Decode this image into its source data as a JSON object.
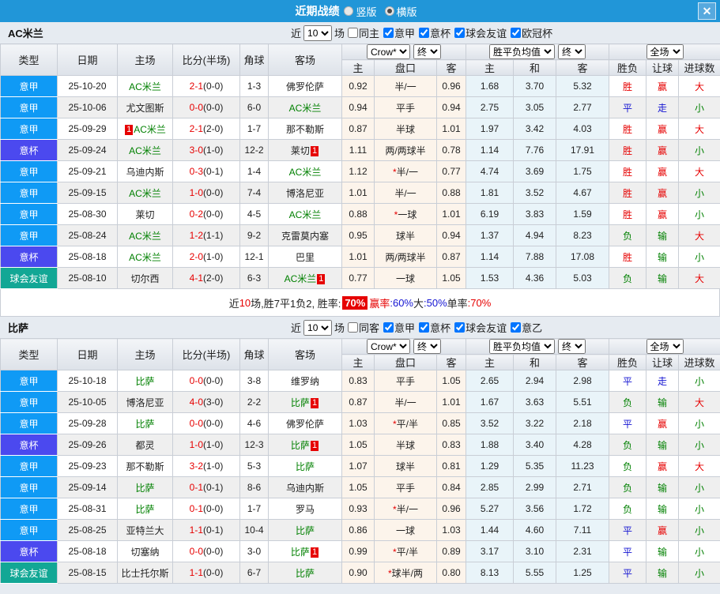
{
  "titlebar": {
    "title": "近期战绩",
    "radios": [
      {
        "label": "竖版",
        "checked": false
      },
      {
        "label": "横版",
        "checked": true
      }
    ],
    "close_glyph": "✕"
  },
  "header": {
    "cols": [
      "类型",
      "日期",
      "主场",
      "比分(半场)",
      "角球",
      "客场"
    ],
    "sub": [
      "主",
      "盘口",
      "客",
      "主",
      "和",
      "客",
      "胜负",
      "让球",
      "进球数"
    ],
    "selects": {
      "odds_source": "Crow*",
      "odds_state": "终",
      "avg_label": "胜平负均值",
      "avg_state": "终",
      "scope": "全场"
    }
  },
  "colors": {
    "league": {
      "意甲": "#0f9af5",
      "意杯": "#4b49ef",
      "球会友谊": "#12a795"
    },
    "result": {
      "r": "#e60000",
      "b": "#1414d2",
      "g": "#008000"
    }
  },
  "teams": [
    {
      "name": "AC米兰",
      "filter": {
        "near": "近",
        "count": "10",
        "games": "场",
        "same": {
          "label": "同主",
          "checked": false
        },
        "leagues": [
          {
            "label": "意甲",
            "checked": true
          },
          {
            "label": "意杯",
            "checked": true
          },
          {
            "label": "球会友谊",
            "checked": true
          },
          {
            "label": "欧冠杯",
            "checked": true
          }
        ]
      },
      "rows": [
        {
          "type": "意甲",
          "date": "25-10-20",
          "home": {
            "name": "AC米兰",
            "green": true
          },
          "score_ft": "2-1",
          "score_ht": "(0-0)",
          "corner": "1-3",
          "away": {
            "name": "佛罗伦萨",
            "green": false
          },
          "odds": [
            "0.92",
            "半/一",
            "0.96"
          ],
          "avg": [
            "1.68",
            "3.70",
            "5.32"
          ],
          "res": [
            [
              "胜",
              "r"
            ],
            [
              "赢",
              "r"
            ],
            [
              "大",
              "r"
            ]
          ]
        },
        {
          "type": "意甲",
          "date": "25-10-06",
          "home": {
            "name": "尤文图斯",
            "green": false
          },
          "score_ft": "0-0",
          "score_ht": "(0-0)",
          "corner": "6-0",
          "away": {
            "name": "AC米兰",
            "green": true
          },
          "odds": [
            "0.94",
            "平手",
            "0.94"
          ],
          "avg": [
            "2.75",
            "3.05",
            "2.77"
          ],
          "res": [
            [
              "平",
              "b"
            ],
            [
              "走",
              "b"
            ],
            [
              "小",
              "g"
            ]
          ]
        },
        {
          "type": "意甲",
          "date": "25-09-29",
          "home": {
            "name": "AC米兰",
            "green": true,
            "badge": "1",
            "badge_pos": "before"
          },
          "score_ft": "2-1",
          "score_ht": "(2-0)",
          "corner": "1-7",
          "away": {
            "name": "那不勒斯",
            "green": false
          },
          "odds": [
            "0.87",
            "半球",
            "1.01"
          ],
          "avg": [
            "1.97",
            "3.42",
            "4.03"
          ],
          "res": [
            [
              "胜",
              "r"
            ],
            [
              "赢",
              "r"
            ],
            [
              "大",
              "r"
            ]
          ]
        },
        {
          "type": "意杯",
          "date": "25-09-24",
          "home": {
            "name": "AC米兰",
            "green": true
          },
          "score_ft": "3-0",
          "score_ht": "(1-0)",
          "corner": "12-2",
          "away": {
            "name": "莱切",
            "green": false,
            "badge": "1",
            "badge_pos": "after"
          },
          "odds": [
            "1.11",
            "两/两球半",
            "0.78"
          ],
          "avg": [
            "1.14",
            "7.76",
            "17.91"
          ],
          "res": [
            [
              "胜",
              "r"
            ],
            [
              "赢",
              "r"
            ],
            [
              "小",
              "g"
            ]
          ]
        },
        {
          "type": "意甲",
          "date": "25-09-21",
          "home": {
            "name": "乌迪内斯",
            "green": false
          },
          "score_ft": "0-3",
          "score_ht": "(0-1)",
          "corner": "1-4",
          "away": {
            "name": "AC米兰",
            "green": true
          },
          "odds": [
            "1.12",
            "*半/一",
            "0.77"
          ],
          "avg": [
            "4.74",
            "3.69",
            "1.75"
          ],
          "res": [
            [
              "胜",
              "r"
            ],
            [
              "赢",
              "r"
            ],
            [
              "大",
              "r"
            ]
          ]
        },
        {
          "type": "意甲",
          "date": "25-09-15",
          "home": {
            "name": "AC米兰",
            "green": true
          },
          "score_ft": "1-0",
          "score_ht": "(0-0)",
          "corner": "7-4",
          "away": {
            "name": "博洛尼亚",
            "green": false
          },
          "odds": [
            "1.01",
            "半/一",
            "0.88"
          ],
          "avg": [
            "1.81",
            "3.52",
            "4.67"
          ],
          "res": [
            [
              "胜",
              "r"
            ],
            [
              "赢",
              "r"
            ],
            [
              "小",
              "g"
            ]
          ]
        },
        {
          "type": "意甲",
          "date": "25-08-30",
          "home": {
            "name": "莱切",
            "green": false
          },
          "score_ft": "0-2",
          "score_ht": "(0-0)",
          "corner": "4-5",
          "away": {
            "name": "AC米兰",
            "green": true
          },
          "odds": [
            "0.88",
            "*一球",
            "1.01"
          ],
          "avg": [
            "6.19",
            "3.83",
            "1.59"
          ],
          "res": [
            [
              "胜",
              "r"
            ],
            [
              "赢",
              "r"
            ],
            [
              "小",
              "g"
            ]
          ]
        },
        {
          "type": "意甲",
          "date": "25-08-24",
          "home": {
            "name": "AC米兰",
            "green": true
          },
          "score_ft": "1-2",
          "score_ht": "(1-1)",
          "corner": "9-2",
          "away": {
            "name": "克雷莫内塞",
            "green": false
          },
          "odds": [
            "0.95",
            "球半",
            "0.94"
          ],
          "avg": [
            "1.37",
            "4.94",
            "8.23"
          ],
          "res": [
            [
              "负",
              "g"
            ],
            [
              "输",
              "g"
            ],
            [
              "大",
              "r"
            ]
          ]
        },
        {
          "type": "意杯",
          "date": "25-08-18",
          "home": {
            "name": "AC米兰",
            "green": true
          },
          "score_ft": "2-0",
          "score_ht": "(1-0)",
          "corner": "12-1",
          "away": {
            "name": "巴里",
            "green": false
          },
          "odds": [
            "1.01",
            "两/两球半",
            "0.87"
          ],
          "avg": [
            "1.14",
            "7.88",
            "17.08"
          ],
          "res": [
            [
              "胜",
              "r"
            ],
            [
              "输",
              "g"
            ],
            [
              "小",
              "g"
            ]
          ]
        },
        {
          "type": "球会友谊",
          "date": "25-08-10",
          "home": {
            "name": "切尔西",
            "green": false
          },
          "score_ft": "4-1",
          "score_ht": "(2-0)",
          "corner": "6-3",
          "away": {
            "name": "AC米兰",
            "green": true,
            "badge": "1",
            "badge_pos": "after"
          },
          "odds": [
            "0.77",
            "一球",
            "1.05"
          ],
          "avg": [
            "1.53",
            "4.36",
            "5.03"
          ],
          "res": [
            [
              "负",
              "g"
            ],
            [
              "输",
              "g"
            ],
            [
              "大",
              "r"
            ]
          ]
        }
      ],
      "summary": [
        {
          "t": "近",
          "c": "k"
        },
        {
          "t": "10",
          "c": "r"
        },
        {
          "t": "场,胜7平1负2, 胜率:",
          "c": "k"
        },
        {
          "t": "70%",
          "bg": true
        },
        {
          "t": "赢率",
          "c": "r"
        },
        {
          "t": ":60%",
          "c": "b"
        },
        {
          "t": " 大",
          "c": "k"
        },
        {
          "t": ":50%",
          "c": "b"
        },
        {
          "t": " 单率",
          "c": "k"
        },
        {
          "t": ":70%",
          "c": "r"
        }
      ]
    },
    {
      "name": "比萨",
      "filter": {
        "near": "近",
        "count": "10",
        "games": "场",
        "same": {
          "label": "同客",
          "checked": false
        },
        "leagues": [
          {
            "label": "意甲",
            "checked": true
          },
          {
            "label": "意杯",
            "checked": true
          },
          {
            "label": "球会友谊",
            "checked": true
          },
          {
            "label": "意乙",
            "checked": true
          }
        ]
      },
      "rows": [
        {
          "type": "意甲",
          "date": "25-10-18",
          "home": {
            "name": "比萨",
            "green": true
          },
          "score_ft": "0-0",
          "score_ht": "(0-0)",
          "corner": "3-8",
          "away": {
            "name": "维罗纳",
            "green": false
          },
          "odds": [
            "0.83",
            "平手",
            "1.05"
          ],
          "avg": [
            "2.65",
            "2.94",
            "2.98"
          ],
          "res": [
            [
              "平",
              "b"
            ],
            [
              "走",
              "b"
            ],
            [
              "小",
              "g"
            ]
          ]
        },
        {
          "type": "意甲",
          "date": "25-10-05",
          "home": {
            "name": "博洛尼亚",
            "green": false
          },
          "score_ft": "4-0",
          "score_ht": "(3-0)",
          "corner": "2-2",
          "away": {
            "name": "比萨",
            "green": true,
            "badge": "1",
            "badge_pos": "after"
          },
          "odds": [
            "0.87",
            "半/一",
            "1.01"
          ],
          "avg": [
            "1.67",
            "3.63",
            "5.51"
          ],
          "res": [
            [
              "负",
              "g"
            ],
            [
              "输",
              "g"
            ],
            [
              "大",
              "r"
            ]
          ]
        },
        {
          "type": "意甲",
          "date": "25-09-28",
          "home": {
            "name": "比萨",
            "green": true
          },
          "score_ft": "0-0",
          "score_ht": "(0-0)",
          "corner": "4-6",
          "away": {
            "name": "佛罗伦萨",
            "green": false
          },
          "odds": [
            "1.03",
            "*平/半",
            "0.85"
          ],
          "avg": [
            "3.52",
            "3.22",
            "2.18"
          ],
          "res": [
            [
              "平",
              "b"
            ],
            [
              "赢",
              "r"
            ],
            [
              "小",
              "g"
            ]
          ]
        },
        {
          "type": "意杯",
          "date": "25-09-26",
          "home": {
            "name": "都灵",
            "green": false
          },
          "score_ft": "1-0",
          "score_ht": "(1-0)",
          "corner": "12-3",
          "away": {
            "name": "比萨",
            "green": true,
            "badge": "1",
            "badge_pos": "after"
          },
          "odds": [
            "1.05",
            "半球",
            "0.83"
          ],
          "avg": [
            "1.88",
            "3.40",
            "4.28"
          ],
          "res": [
            [
              "负",
              "g"
            ],
            [
              "输",
              "g"
            ],
            [
              "小",
              "g"
            ]
          ]
        },
        {
          "type": "意甲",
          "date": "25-09-23",
          "home": {
            "name": "那不勒斯",
            "green": false
          },
          "score_ft": "3-2",
          "score_ht": "(1-0)",
          "corner": "5-3",
          "away": {
            "name": "比萨",
            "green": true
          },
          "odds": [
            "1.07",
            "球半",
            "0.81"
          ],
          "avg": [
            "1.29",
            "5.35",
            "11.23"
          ],
          "res": [
            [
              "负",
              "g"
            ],
            [
              "赢",
              "r"
            ],
            [
              "大",
              "r"
            ]
          ]
        },
        {
          "type": "意甲",
          "date": "25-09-14",
          "home": {
            "name": "比萨",
            "green": true
          },
          "score_ft": "0-1",
          "score_ht": "(0-1)",
          "corner": "8-6",
          "away": {
            "name": "乌迪内斯",
            "green": false
          },
          "odds": [
            "1.05",
            "平手",
            "0.84"
          ],
          "avg": [
            "2.85",
            "2.99",
            "2.71"
          ],
          "res": [
            [
              "负",
              "g"
            ],
            [
              "输",
              "g"
            ],
            [
              "小",
              "g"
            ]
          ]
        },
        {
          "type": "意甲",
          "date": "25-08-31",
          "home": {
            "name": "比萨",
            "green": true
          },
          "score_ft": "0-1",
          "score_ht": "(0-0)",
          "corner": "1-7",
          "away": {
            "name": "罗马",
            "green": false
          },
          "odds": [
            "0.93",
            "*半/一",
            "0.96"
          ],
          "avg": [
            "5.27",
            "3.56",
            "1.72"
          ],
          "res": [
            [
              "负",
              "g"
            ],
            [
              "输",
              "g"
            ],
            [
              "小",
              "g"
            ]
          ]
        },
        {
          "type": "意甲",
          "date": "25-08-25",
          "home": {
            "name": "亚特兰大",
            "green": false
          },
          "score_ft": "1-1",
          "score_ht": "(0-1)",
          "corner": "10-4",
          "away": {
            "name": "比萨",
            "green": true
          },
          "odds": [
            "0.86",
            "一球",
            "1.03"
          ],
          "avg": [
            "1.44",
            "4.60",
            "7.11"
          ],
          "res": [
            [
              "平",
              "b"
            ],
            [
              "赢",
              "r"
            ],
            [
              "小",
              "g"
            ]
          ]
        },
        {
          "type": "意杯",
          "date": "25-08-18",
          "home": {
            "name": "切塞纳",
            "green": false
          },
          "score_ft": "0-0",
          "score_ht": "(0-0)",
          "corner": "3-0",
          "away": {
            "name": "比萨",
            "green": true,
            "badge": "1",
            "badge_pos": "after"
          },
          "odds": [
            "0.99",
            "*平/半",
            "0.89"
          ],
          "avg": [
            "3.17",
            "3.10",
            "2.31"
          ],
          "res": [
            [
              "平",
              "b"
            ],
            [
              "输",
              "g"
            ],
            [
              "小",
              "g"
            ]
          ]
        },
        {
          "type": "球会友谊",
          "date": "25-08-15",
          "home": {
            "name": "比士托尔斯",
            "green": false
          },
          "score_ft": "1-1",
          "score_ht": "(0-0)",
          "corner": "6-7",
          "away": {
            "name": "比萨",
            "green": true
          },
          "odds": [
            "0.90",
            "*球半/两",
            "0.80"
          ],
          "avg": [
            "8.13",
            "5.55",
            "1.25"
          ],
          "res": [
            [
              "平",
              "b"
            ],
            [
              "输",
              "g"
            ],
            [
              "小",
              "g"
            ]
          ]
        }
      ],
      "summary": null
    }
  ]
}
